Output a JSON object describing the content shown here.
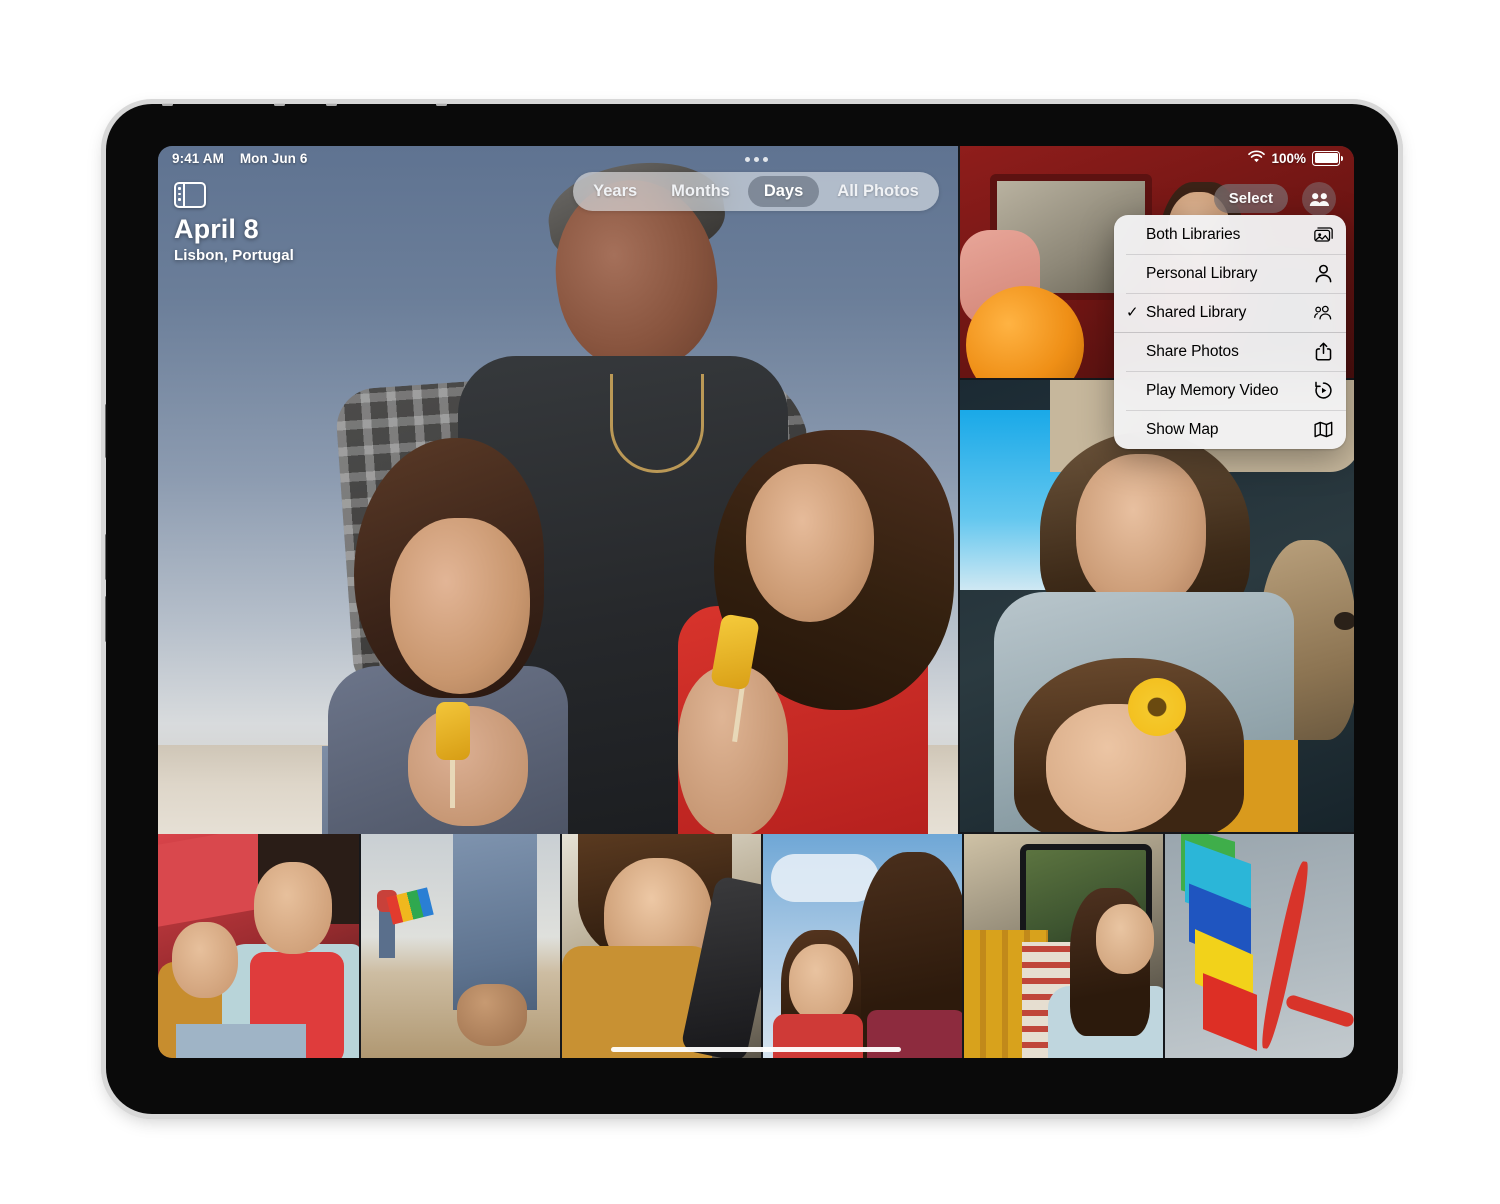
{
  "status_bar": {
    "time": "9:41 AM",
    "date": "Mon Jun 6",
    "battery_percent": "100%",
    "wifi_icon": "wifi-icon",
    "battery_icon": "battery-icon"
  },
  "toolbar": {
    "sidebar_toggle_icon": "sidebar-toggle-icon",
    "grabber_icon": "grabber-dots-icon",
    "select_label": "Select",
    "people_icon": "people-group-icon"
  },
  "day_header": {
    "title": "April 8",
    "location": "Lisbon, Portugal"
  },
  "segmented_control": {
    "selected": "Days",
    "items": [
      {
        "label": "Years",
        "active": false
      },
      {
        "label": "Months",
        "active": false
      },
      {
        "label": "Days",
        "active": true
      },
      {
        "label": "All Photos",
        "active": false
      }
    ]
  },
  "context_menu": {
    "items": [
      {
        "label": "Both Libraries",
        "checked": false,
        "icon": "photo-stack-icon"
      },
      {
        "label": "Personal Library",
        "checked": false,
        "icon": "person-icon"
      },
      {
        "label": "Shared Library",
        "checked": true,
        "icon": "two-people-icon"
      },
      {
        "label": "Share Photos",
        "checked": false,
        "icon": "share-up-arrow-icon"
      },
      {
        "label": "Play Memory Video",
        "checked": false,
        "icon": "play-memory-icon"
      },
      {
        "label": "Show Map",
        "checked": false,
        "icon": "map-icon"
      }
    ]
  },
  "photo_grid": {
    "hero": "family-with-popsicles-on-beach",
    "thumbnails": [
      "girl-in-red-van-with-soccer-ball",
      "two-girls-and-dog-with-sunflower",
      "two-girls-resting-red-wall",
      "bare-feet-in-sand-with-kite",
      "girl-leaning-on-car-window",
      "two-girls-against-sky",
      "girl-looking-out-van-window",
      "colorful-kite-against-sky"
    ]
  },
  "home_indicator": "home-indicator-bar",
  "colors": {
    "accent": "#0a84ff",
    "menu_background": "#f2f2f4",
    "segment_active": "#6c7684",
    "page_background": "#ffffff"
  }
}
